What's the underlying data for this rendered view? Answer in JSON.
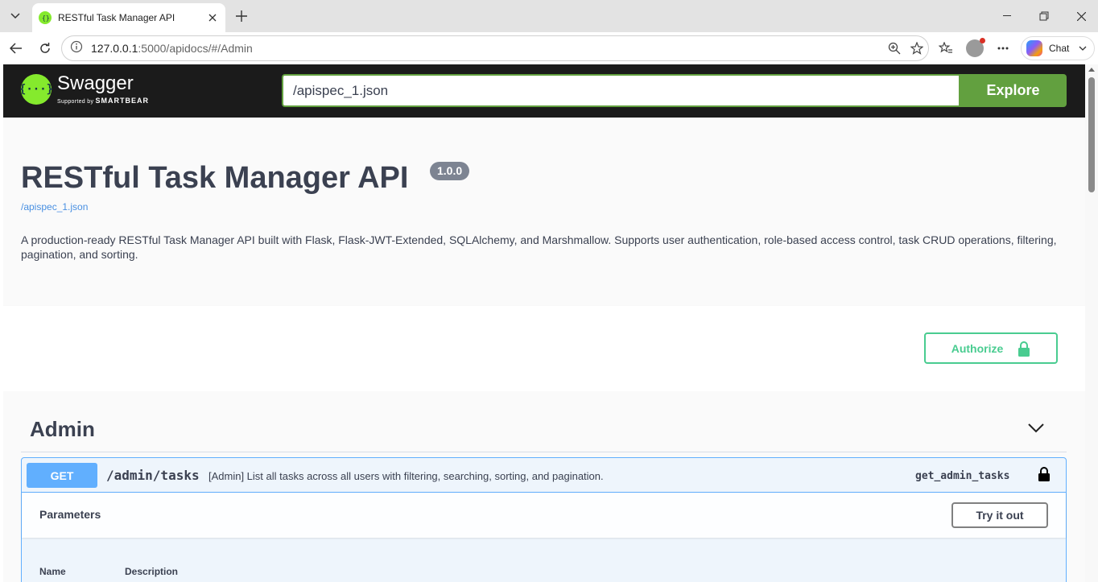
{
  "browser": {
    "tab_title": "RESTful Task Manager API",
    "url_host": "127.0.0.1",
    "url_rest": ":5000/apidocs/#/Admin",
    "chat_label": "Chat"
  },
  "swagger": {
    "logo_name": "Swagger",
    "logo_sub_prefix": "Supported by",
    "logo_sub_brand": "SMARTBEAR",
    "spec_url_value": "/apispec_1.json",
    "explore_label": "Explore"
  },
  "info": {
    "title": "RESTful Task Manager API",
    "version": "1.0.0",
    "spec_link": "/apispec_1.json",
    "description": "A production-ready RESTful Task Manager API built with Flask, Flask-JWT-Extended, SQLAlchemy, and Marshmallow. Supports user authentication, role-based access control, task CRUD operations, filtering, pagination, and sorting."
  },
  "auth": {
    "authorize_label": "Authorize"
  },
  "tag": {
    "name": "Admin",
    "operation": {
      "method": "GET",
      "path": "/admin/tasks",
      "summary": "[Admin] List all tasks across all users with filtering, searching, sorting, and pagination.",
      "operation_id": "get_admin_tasks",
      "parameters_title": "Parameters",
      "try_label": "Try it out",
      "columns": [
        "Name",
        "Description"
      ]
    }
  },
  "colors": {
    "get": "#61affe",
    "swagger_green": "#62a03f",
    "authorize_green": "#49cc90"
  }
}
